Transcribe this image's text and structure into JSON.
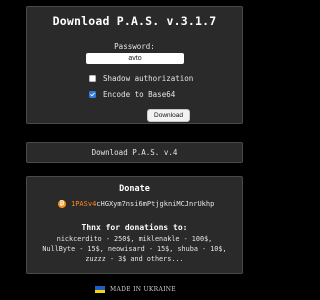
{
  "main": {
    "title": "Download P.A.S. v.3.1.7",
    "password_label": "Password:",
    "password_value": "avto",
    "options": [
      {
        "label": "Shadow authorization",
        "checked": false
      },
      {
        "label": "Encode to Base64",
        "checked": true
      }
    ],
    "download_button_label": "Download"
  },
  "v4_link": "Download P.A.S. v.4",
  "donate": {
    "title": "Donate",
    "btc_icon": "bitcoin-icon",
    "btc_symbol": "₿",
    "address_prefix": "1PASv4",
    "address_rest": "cHGXym7nsi6mPtjgkniMCJnrUkhp",
    "thanks_title": "Thnx for donations to:",
    "thanks_lines": [
      "nickcerdito - 250$, miklenakle - 100$,",
      "NullByte - 15$, neowisard - 15$, shuba - 10$,",
      "zuzzz - 3$ and others..."
    ]
  },
  "footer": {
    "flag_icon": "ukraine-flag-icon",
    "text": "MADE IN UKRAINE"
  },
  "colors": {
    "background": "#000000",
    "panel": "#2a2a2a",
    "panel_border": "#4a4a4a",
    "checkbox_checked": "#2f7bd9",
    "btc_orange": "#f7931a",
    "address_prefix": "#ff8a1e",
    "flag_blue": "#1b5fc4",
    "flag_yellow": "#f5d312"
  }
}
